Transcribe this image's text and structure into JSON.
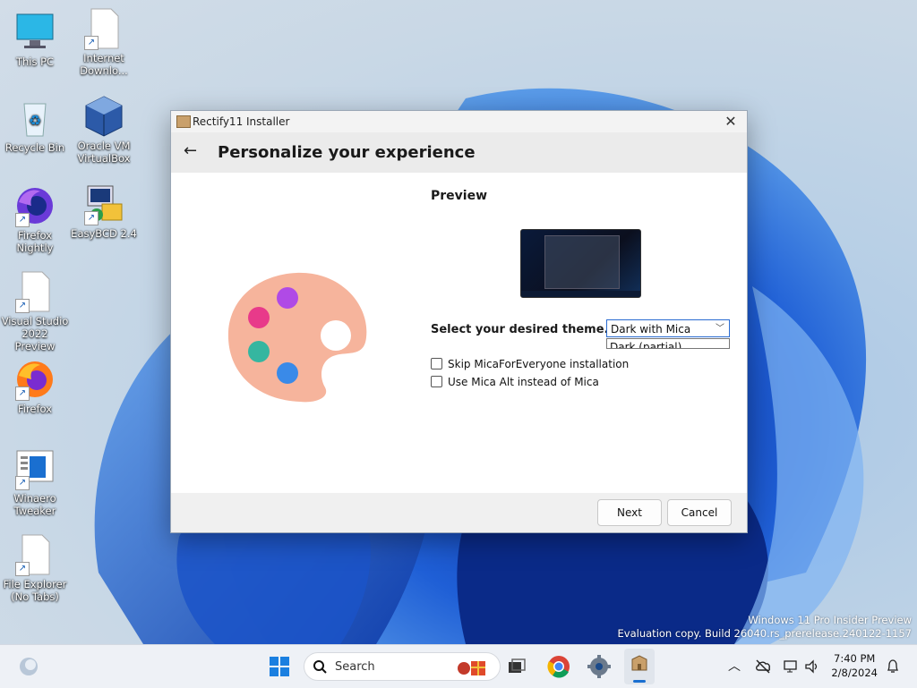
{
  "desktop": {
    "icons": [
      {
        "label1": "This PC",
        "label2": ""
      },
      {
        "label1": "Internet",
        "label2": "Downlo..."
      },
      {
        "label1": "Recycle Bin",
        "label2": ""
      },
      {
        "label1": "Oracle VM",
        "label2": "VirtualBox"
      },
      {
        "label1": "Firefox",
        "label2": "Nightly"
      },
      {
        "label1": "EasyBCD 2.4",
        "label2": ""
      },
      {
        "label1": "Visual Studio",
        "label2": "2022 Preview"
      },
      {
        "label1": "Firefox",
        "label2": ""
      },
      {
        "label1": "Winaero",
        "label2": "Tweaker"
      },
      {
        "label1": "File Explorer",
        "label2": "(No Tabs)"
      }
    ],
    "watermark": {
      "line1": "Windows 11 Pro Insider Preview",
      "line2": "Evaluation copy. Build 26040.rs_prerelease.240122-1157"
    }
  },
  "window": {
    "title": "Rectify11 Installer",
    "close": "✕",
    "back": "←",
    "heading": "Personalize your experience",
    "preview_label": "Preview",
    "theme_label": "Select your desired theme.",
    "theme_selected": "Dark with Mica",
    "theme_option_visible": "Dark (partial)",
    "checkbox1": "Skip MicaForEveryone installation",
    "checkbox2": "Use Mica Alt instead of Mica",
    "next": "Next",
    "cancel": "Cancel"
  },
  "taskbar": {
    "search_placeholder": "Search",
    "time": "7:40 PM",
    "date": "2/8/2024"
  },
  "colors": {
    "accent": "#2a6bd1",
    "taskbar": "#eef1f6"
  }
}
